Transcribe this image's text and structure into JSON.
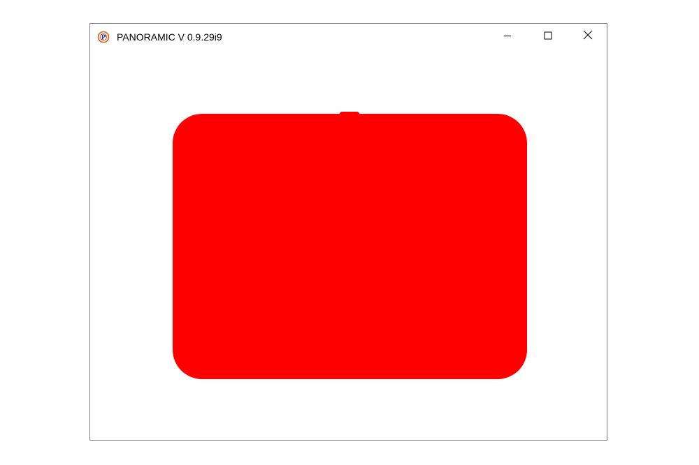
{
  "window": {
    "title": "PANORAMIC V 0.9.29i9",
    "app_icon": "panoramic-logo-icon",
    "controls": {
      "minimize_icon": "minimize-icon",
      "maximize_icon": "maximize-icon",
      "close_icon": "close-icon"
    }
  },
  "canvas": {
    "background_color": "#ffffff",
    "shape": {
      "kind": "rounded-rectangle",
      "fill_color": "#ff0000"
    }
  },
  "colors": {
    "window_border": "#7a7a7a",
    "title_text": "#000000"
  }
}
